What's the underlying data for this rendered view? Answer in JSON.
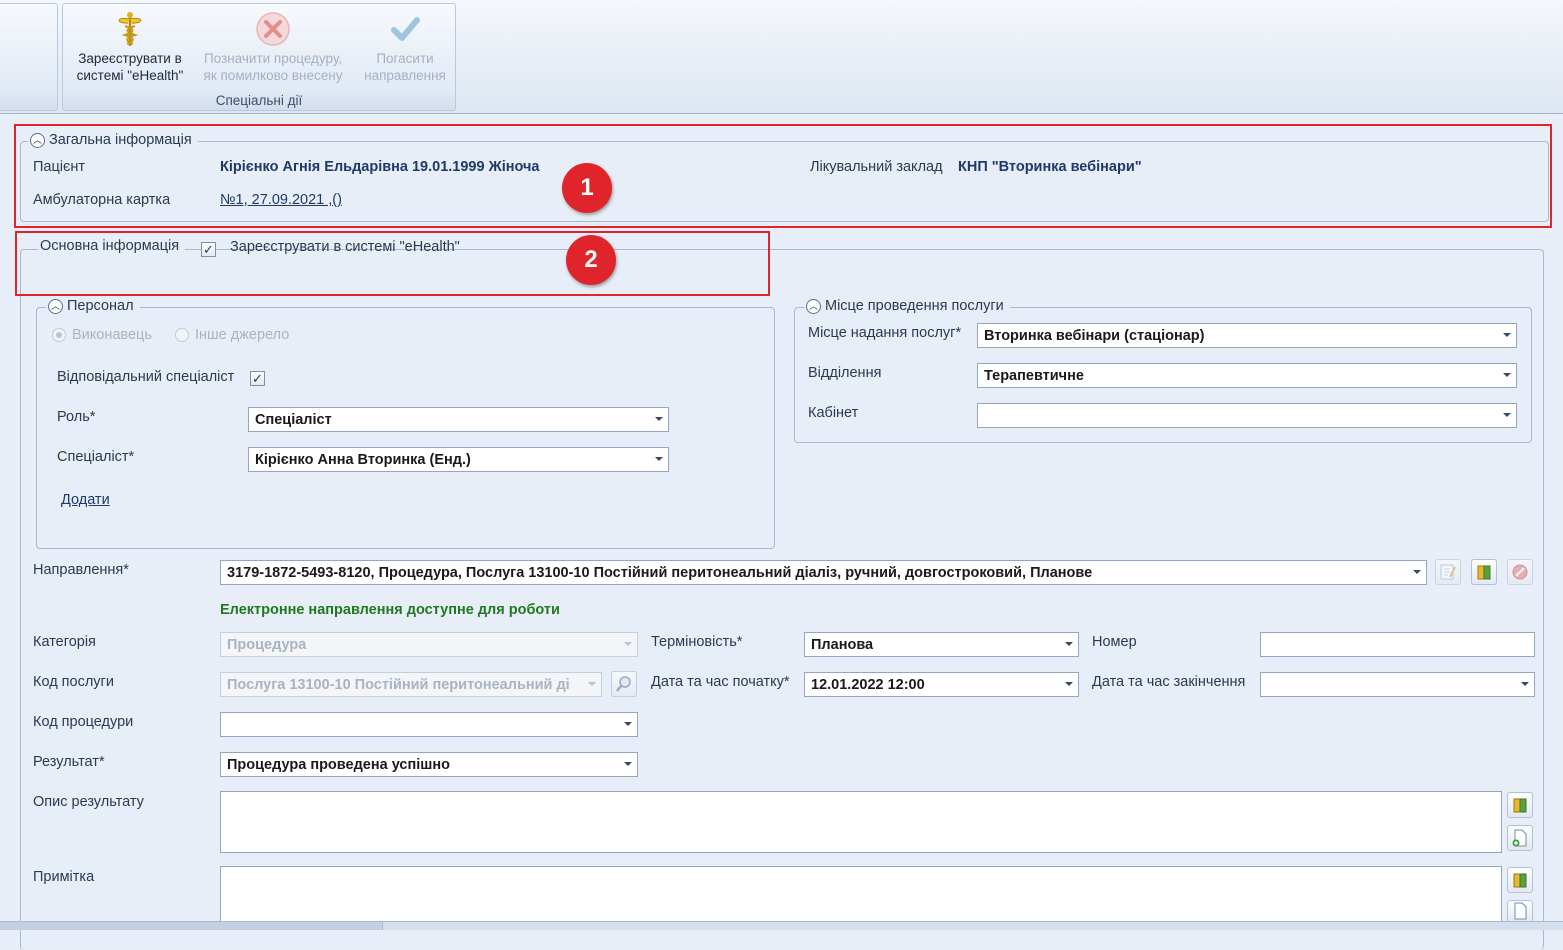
{
  "ribbon": {
    "register_btn": {
      "line1": "Зареєструвати в",
      "line2": "системі \"eHealth\"",
      "icon": "caduceus-icon"
    },
    "mark_error_btn": {
      "line1": "Позначити процедуру,",
      "line2": "як помилково внесену",
      "icon": "red-x-icon"
    },
    "repay_btn": {
      "line1": "Погасити",
      "line2": "направлення",
      "icon": "checkmark-icon"
    },
    "group_label": "Спеціальні дії"
  },
  "general": {
    "legend": "Загальна інформація",
    "patient_label": "Пацієнт",
    "patient_value": "Кірієнко Агнія Ельдарівна 19.01.1999 Жіноча",
    "facility_label": "Лікувальний заклад",
    "facility_value": "КНП \"Вторинка вебінари\"",
    "card_label": "Амбулаторна картка",
    "card_value": "№1, 27.09.2021 ,()"
  },
  "main": {
    "legend": "Основна інформація",
    "register_checkbox_label": "Зареєструвати в системі \"eHealth\"",
    "register_checked": true
  },
  "personnel": {
    "legend": "Персонал",
    "radio_executor": "Виконавець",
    "radio_other": "Інше джерело",
    "responsible_label": "Відповідальний спеціаліст",
    "responsible_checked": true,
    "role_label": "Роль*",
    "role_value": "Спеціаліст",
    "specialist_label": "Спеціаліст*",
    "specialist_value": "Кірієнко Анна Вторинка (Енд.)",
    "add_link": "Додати"
  },
  "place": {
    "legend": "Місце проведення послуги",
    "place_label": "Місце надання послуг*",
    "place_value": "Вторинка вебінари (стаціонар)",
    "dept_label": "Відділення",
    "dept_value": "Терапевтичне",
    "cabinet_label": "Кабінет",
    "cabinet_value": ""
  },
  "referral": {
    "label": "Направлення*",
    "value": "3179-1872-5493-8120, Процедура, Послуга 13100-10 Постійний перитонеальний діаліз, ручний, довгостроковий, Планове",
    "status": "Електронне направлення доступне для роботи"
  },
  "details": {
    "category_label": "Категорія",
    "category_value": "Процедура",
    "urgency_label": "Терміновість*",
    "urgency_value": "Планова",
    "number_label": "Номер",
    "number_value": "",
    "service_code_label": "Код послуги",
    "service_code_value": "Послуга 13100-10 Постійний перитонеальний ді",
    "start_label": "Дата та час початку*",
    "start_value": "12.01.2022 12:00",
    "end_label": "Дата та час закінчення",
    "end_value": "",
    "procedure_code_label": "Код процедури",
    "procedure_code_value": "",
    "result_label": "Результат*",
    "result_value": "Процедура проведена успішно",
    "result_desc_label": "Опис результату",
    "note_label": "Примітка"
  },
  "annotations": {
    "badge1": "1",
    "badge2": "2"
  },
  "colors": {
    "highlight": "#e0242b",
    "status_ok": "#1f7a1f",
    "background": "#e8eef7"
  }
}
